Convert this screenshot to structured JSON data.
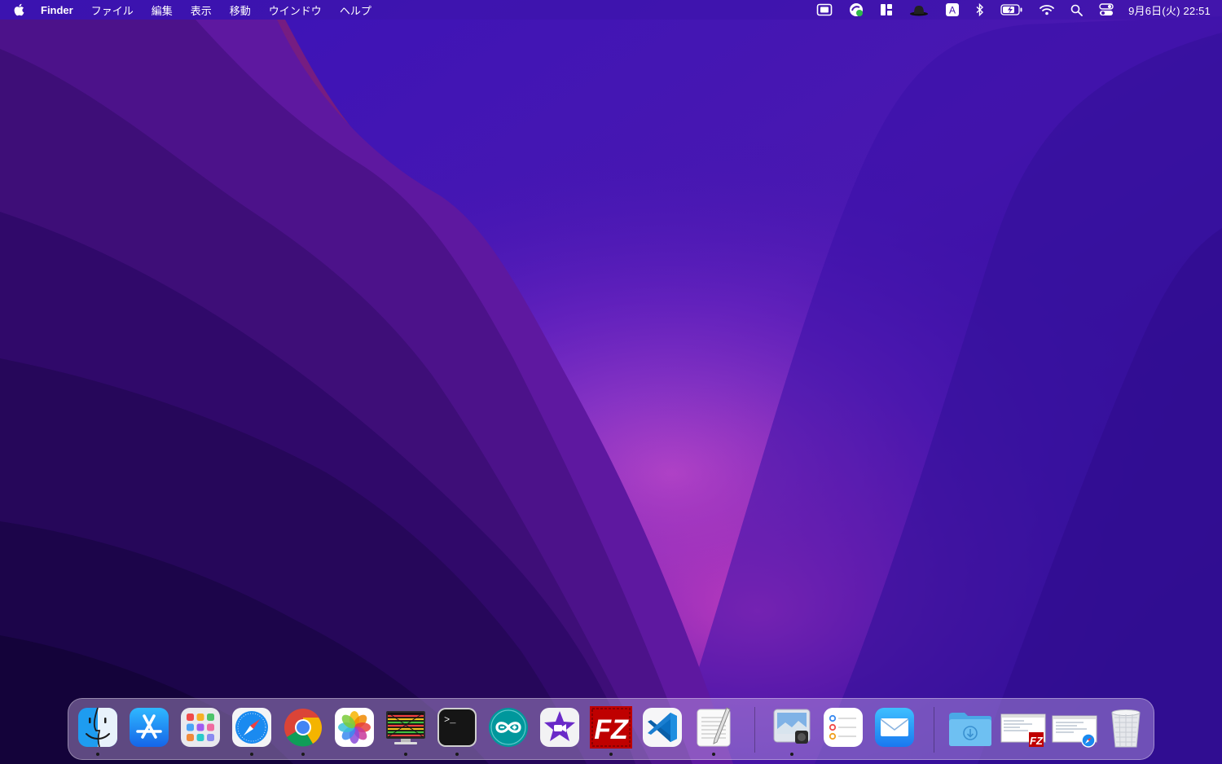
{
  "menubar": {
    "app_name": "Finder",
    "menus": [
      "ファイル",
      "編集",
      "表示",
      "移動",
      "ウインドウ",
      "ヘルプ"
    ],
    "status_icons": [
      "stage-manager-icon",
      "sync-status-icon",
      "window-layout-icon",
      "hat-icon",
      "input-method-icon",
      "bluetooth-icon",
      "battery-icon",
      "wifi-icon",
      "spotlight-icon",
      "control-center-icon"
    ],
    "input_method": "A",
    "clock": "9月6日(火)  22:51"
  },
  "dock": {
    "apps": [
      {
        "name": "finder-icon",
        "running": true
      },
      {
        "name": "app-store-icon",
        "running": false
      },
      {
        "name": "launchpad-icon",
        "running": false
      },
      {
        "name": "safari-icon",
        "running": true
      },
      {
        "name": "chrome-icon",
        "running": true
      },
      {
        "name": "photos-icon",
        "running": false
      },
      {
        "name": "screen-app-icon",
        "running": true
      },
      {
        "name": "terminal-icon",
        "running": true
      },
      {
        "name": "arduino-icon",
        "running": false
      },
      {
        "name": "imovie-icon",
        "running": false
      },
      {
        "name": "filezilla-icon",
        "running": true
      },
      {
        "name": "vscode-icon",
        "running": false
      },
      {
        "name": "textedit-icon",
        "running": true
      },
      {
        "name": "preview-icon",
        "running": true
      },
      {
        "name": "reminders-icon",
        "running": false
      },
      {
        "name": "mail-icon",
        "running": false
      }
    ],
    "stacks": [
      "downloads-folder-icon",
      "filezilla-window-icon",
      "safari-window-icon",
      "trash-icon"
    ],
    "terminal_prompt": ">_",
    "filezilla_label": "FZ"
  },
  "colors": {
    "menubar_bg": "#3c14aa",
    "wallpaper_dark": "#1a0850",
    "wallpaper_accent": "#b040c8"
  }
}
